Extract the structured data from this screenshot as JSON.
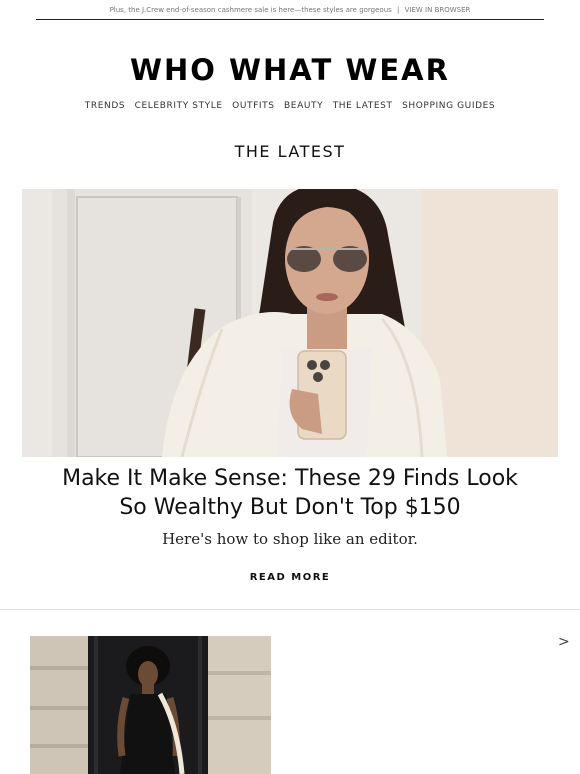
{
  "preheader": {
    "text": "Plus, the J.Crew end-of-season cashmere sale is here—these styles are gorgeous",
    "separator": "|",
    "link": "VIEW IN BROWSER"
  },
  "brand": {
    "logo": "WHO WHAT WEAR"
  },
  "nav": {
    "items": [
      "TRENDS",
      "CELEBRITY STYLE",
      "OUTFITS",
      "BEAUTY",
      "THE LATEST",
      "SHOPPING GUIDES"
    ]
  },
  "section": {
    "title": "THE LATEST"
  },
  "article": {
    "headline_line1": "Make It Make Sense: These 29 Finds Look",
    "headline_line2": "So Wealthy But Don't Top $150",
    "dek": "Here's how to shop like an editor.",
    "cta": "READ MORE"
  },
  "carousel": {
    "next_glyph": ">"
  },
  "colors": {
    "text": "#111111",
    "muted": "#777777",
    "divider": "#e2e2e2"
  }
}
